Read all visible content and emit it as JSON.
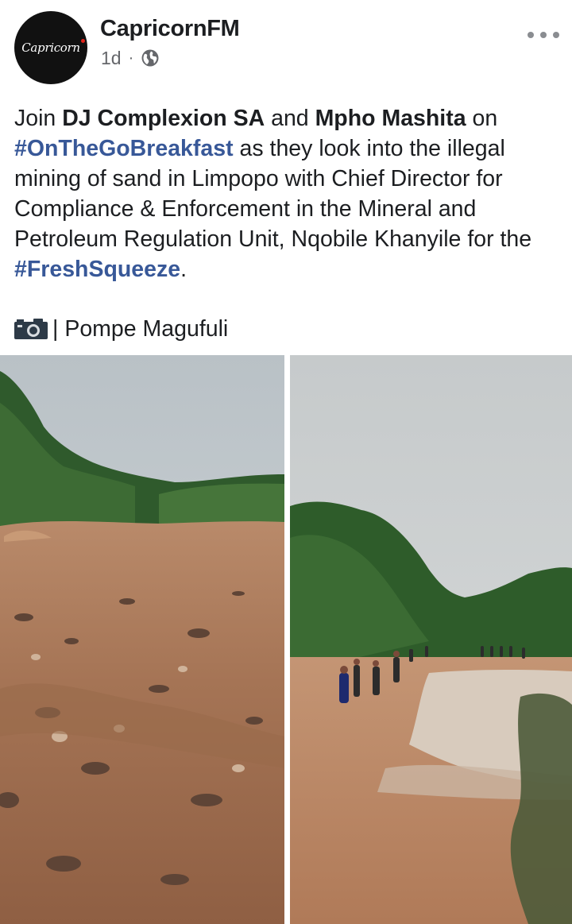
{
  "post": {
    "page_name": "CapricornFM",
    "avatar_text": "Capricorn",
    "time": "1d",
    "separator": "·",
    "privacy_icon": "globe-icon",
    "more_icon": "more-options-icon",
    "text": {
      "p1": "Join ",
      "host1": "DJ Complexion SA",
      "p2": " and ",
      "host2": "Mpho Mashita",
      "p3": " on ",
      "hashtag1": "#OnTheGoBreakfast",
      "p4": " as they look into the illegal mining of sand in Limpopo with Chief Director for Compliance & Enforcement in the Mineral and Petroleum Regulation Unit, Nqobile Khanyile for the ",
      "hashtag2": "#FreshSqueeze",
      "p5": "."
    },
    "credit": {
      "icon": "camera-icon",
      "text": "| Pompe Magufuli"
    },
    "photos": [
      {
        "name": "sandy-riverbed-photo",
        "icon": "photo"
      },
      {
        "name": "river-people-photo",
        "icon": "photo"
      }
    ]
  },
  "colors": {
    "link": "#385898",
    "text": "#1c1e21",
    "meta": "#65676b"
  }
}
